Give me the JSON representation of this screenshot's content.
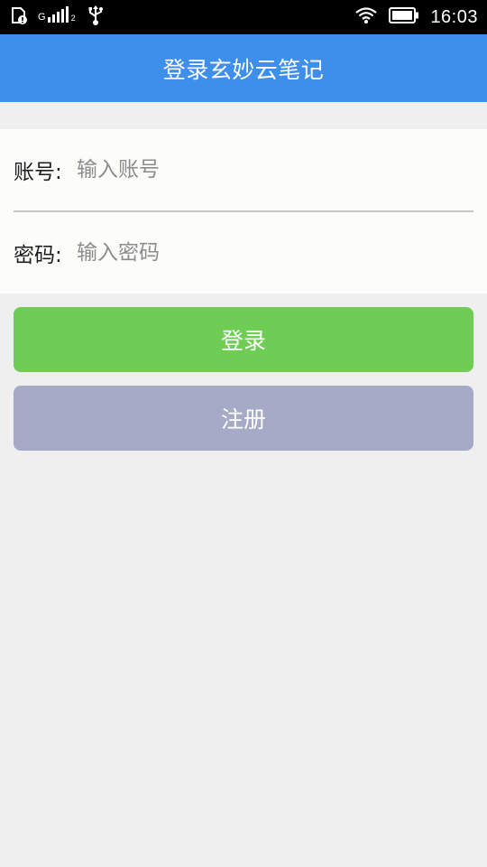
{
  "status_bar": {
    "time": "16:03",
    "network_label": "G",
    "sim_label": "2",
    "icons": [
      "sim-card-icon",
      "signal-icon",
      "usb-icon",
      "wifi-icon",
      "battery-icon"
    ]
  },
  "app_bar": {
    "title": "登录玄妙云笔记"
  },
  "form": {
    "account_label": "账号:",
    "account_placeholder": "输入账号",
    "account_value": "",
    "password_label": "密码:",
    "password_placeholder": "输入密码",
    "password_value": ""
  },
  "buttons": {
    "login_label": "登录",
    "register_label": "注册"
  },
  "colors": {
    "app_bar": "#3e8eec",
    "login_button": "#6fcd55",
    "register_button": "#a5aac6",
    "background": "#efefef"
  }
}
